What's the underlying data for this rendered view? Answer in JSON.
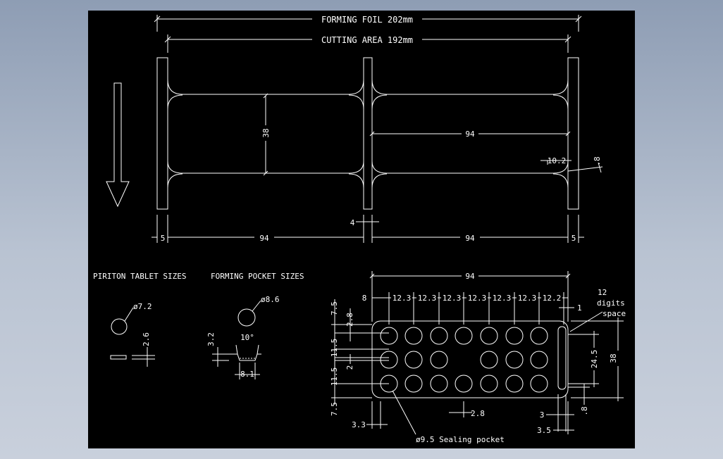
{
  "drawing": {
    "forming_foil_label": "FORMING FOIL 202mm",
    "cutting_area_label": "CUTTING AREA 192mm",
    "top_dims": {
      "height_38": "38",
      "width_94_inner": "94",
      "dim_10_2": "10.2",
      "dim_8": ".8",
      "gap_4": "4",
      "left_5": "5",
      "bottom_94_left": "94",
      "bottom_94_right": "94",
      "right_5": "5"
    },
    "tablet": {
      "title": "PIRITON TABLET SIZES",
      "diameter": "ø7.2",
      "thickness": "2.6"
    },
    "pocket": {
      "title": "FORMING POCKET SIZES",
      "diameter": "ø8.6",
      "angle": "10°",
      "depth": "3.2",
      "bottom": "8.1"
    },
    "blister": {
      "width_94": "94",
      "pitch_first": "8",
      "pitches": [
        "12.3",
        "12.3",
        "12.3",
        "12.3",
        "12.3",
        "12.3",
        "12.2"
      ],
      "digits_line1": "12",
      "digits_line2": "digits",
      "digits_line3": "space",
      "dim_1": "1",
      "dim_7_5_top": "7.5",
      "dim_2_8": "2.8",
      "dim_11_5_a": "11.5",
      "dim_2": "2",
      "dim_11_5_b": "11.5",
      "dim_24_5": "24.5",
      "dim_38": "38",
      "dim_7_5_bottom": "7.5",
      "dim_2_8_bottom": "2.8",
      "dim_3": "3",
      "dim_8_small": ".8",
      "dim_3_3": "3.3",
      "dim_3_5": "3.5",
      "sealing_pocket": "ø9.5 Sealing pocket"
    }
  }
}
